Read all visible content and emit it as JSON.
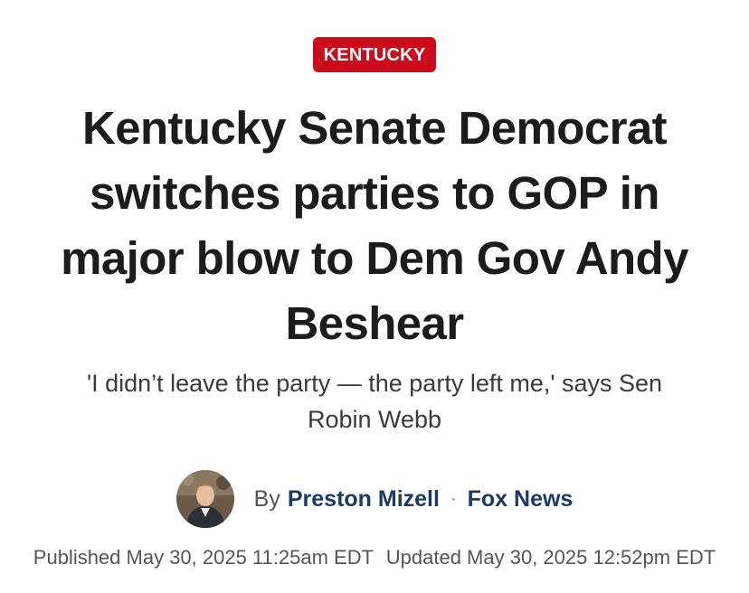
{
  "category": {
    "label": "KENTUCKY",
    "color": "#cc0c1b"
  },
  "headline": "Kentucky Senate Democrat switches parties to GOP in major blow to Dem Gov Andy Beshear",
  "subheadline": "'I didn’t leave the party — the party left me,' says Sen Robin Webb",
  "byline": {
    "prefix": "By",
    "author": "Preston Mizell",
    "separator": "·",
    "publisher": "Fox News",
    "link_color": "#1b3a66",
    "avatar_icon": "author-photo"
  },
  "timestamps": {
    "published": "Published May 30, 2025 11:25am EDT",
    "updated": "Updated May 30, 2025 12:52pm EDT"
  }
}
